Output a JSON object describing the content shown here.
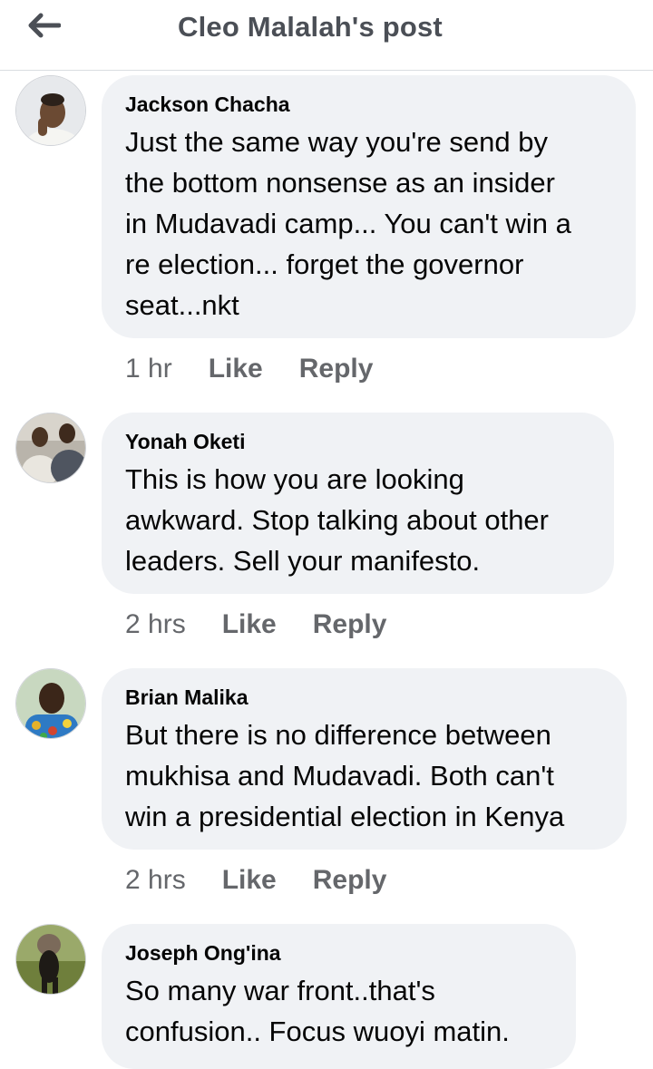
{
  "header": {
    "title": "Cleo Malalah's post",
    "back_icon": "arrow-left-icon"
  },
  "comments": [
    {
      "author": "Jackson Chacha",
      "text": "Just the same way you're send by\nthe bottom nonsense as an insider\nin Mudavadi camp... You can't win a\nre election... forget the governor\nseat...nkt",
      "time": "1 hr",
      "like_label": "Like",
      "reply_label": "Reply"
    },
    {
      "author": "Yonah Oketi",
      "text": "This is how you are looking\nawkward. Stop talking about other\nleaders. Sell your manifesto.",
      "time": "2 hrs",
      "like_label": "Like",
      "reply_label": "Reply"
    },
    {
      "author": "Brian Malika",
      "text": "But there is no difference between\nmukhisa and Mudavadi. Both can't\nwin a presidential election in Kenya",
      "time": "2 hrs",
      "like_label": "Like",
      "reply_label": "Reply"
    },
    {
      "author": "Joseph Ong'ina",
      "text": "So many war front..that's\nconfusion.. Focus wuoyi matin.",
      "time": "",
      "like_label": "",
      "reply_label": ""
    }
  ],
  "colors": {
    "bubble": "#f0f2f5",
    "muted_text": "#65676b",
    "title": "#4b4f56"
  }
}
